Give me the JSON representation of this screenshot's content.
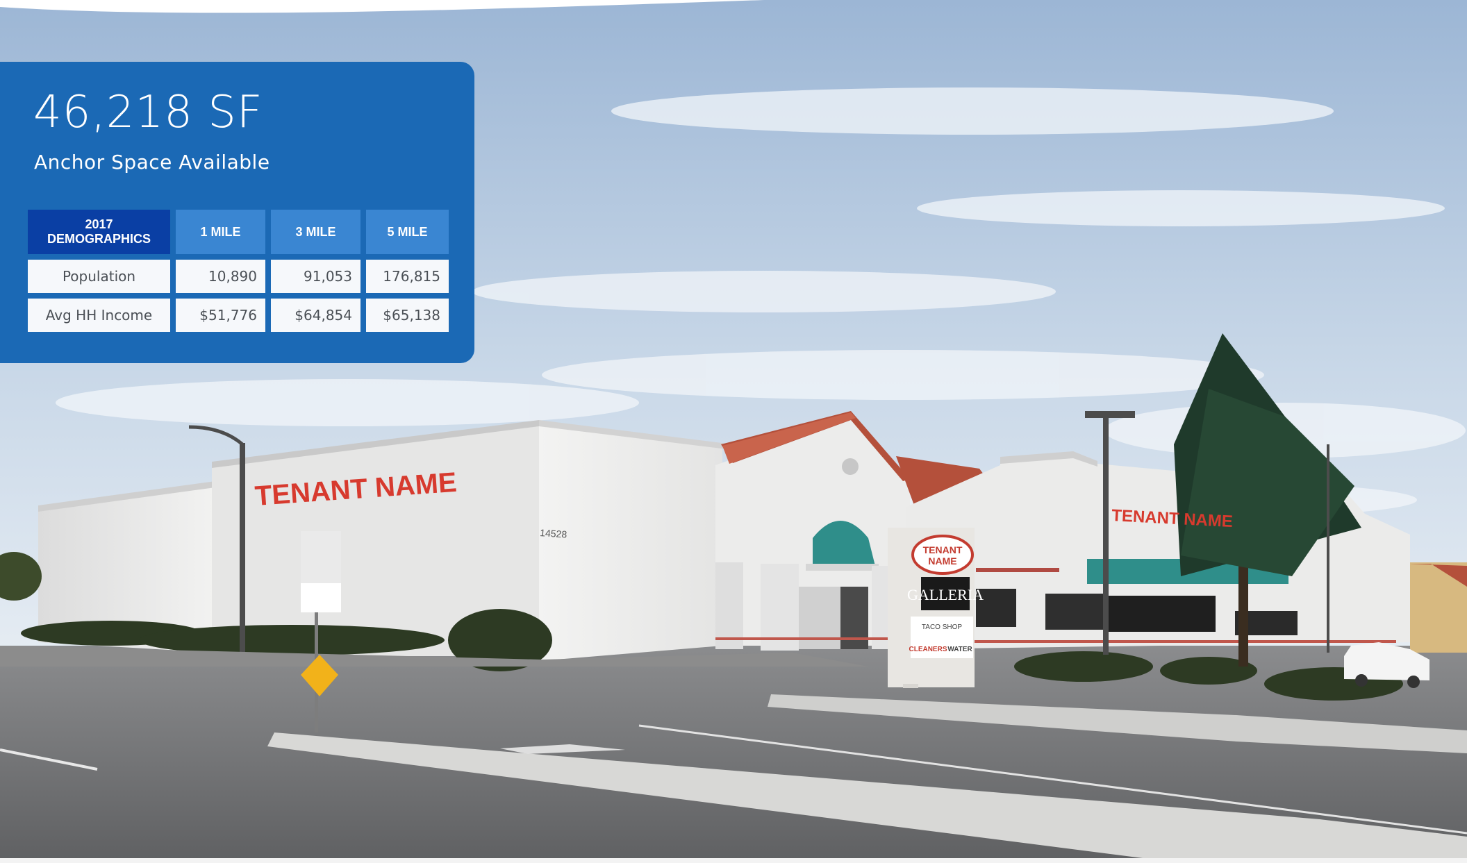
{
  "panel": {
    "headline": "46,218 SF",
    "subhead": "Anchor Space Available"
  },
  "demographics": {
    "corner_line1": "2017",
    "corner_line2": "DEMOGRAPHICS",
    "columns": [
      "1 MILE",
      "3 MILE",
      "5 MILE"
    ],
    "rows": [
      {
        "label": "Population",
        "values": [
          "10,890",
          "91,053",
          "176,815"
        ]
      },
      {
        "label": "Avg HH Income",
        "values": [
          "$51,776",
          "$64,854",
          "$65,138"
        ]
      }
    ]
  },
  "photo": {
    "signs": {
      "facade_left": "TENANT NAME",
      "facade_right": "TENANT NAME",
      "pylon_top_line1": "TENANT",
      "pylon_top_line2": "NAME",
      "pylon_center": "GALLERIA",
      "pylon_panel_1": "TACO SHOP",
      "pylon_panel_2": "CLEANERS",
      "pylon_panel_3": "WATER",
      "address_number": "14528"
    },
    "colors": {
      "sky_top": "#9fb8d6",
      "sky_bottom": "#e6edf4",
      "building": "#e9e9e8",
      "roof_tile": "#b4503b",
      "sign_red": "#d73a2e",
      "asphalt": "#6e6f71",
      "teal_awning": "#2f8e8a",
      "panel_blue": "#1b69b5"
    }
  }
}
